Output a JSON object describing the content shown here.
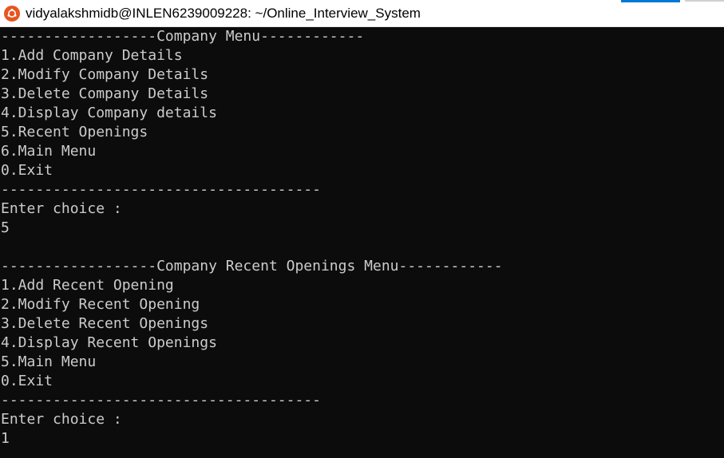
{
  "window": {
    "title": "vidyalakshmidb@INLEN6239009228: ~/Online_Interview_System",
    "accent_color": "#0078d7",
    "app_icon": "ubuntu-icon",
    "app_icon_color": "#e95420"
  },
  "terminal": {
    "background": "#0c0c0c",
    "foreground": "#cccccc",
    "lines": [
      "------------------Company Menu------------",
      "1.Add Company Details",
      "2.Modify Company Details",
      "3.Delete Company Details",
      "4.Display Company details",
      "5.Recent Openings",
      "6.Main Menu",
      "0.Exit",
      "-------------------------------------",
      "Enter choice :",
      "5",
      "",
      "------------------Company Recent Openings Menu------------",
      "1.Add Recent Opening",
      "2.Modify Recent Opening",
      "3.Delete Recent Openings",
      "4.Display Recent Openings",
      "5.Main Menu",
      "0.Exit",
      "-------------------------------------",
      "Enter choice :",
      "1"
    ]
  }
}
